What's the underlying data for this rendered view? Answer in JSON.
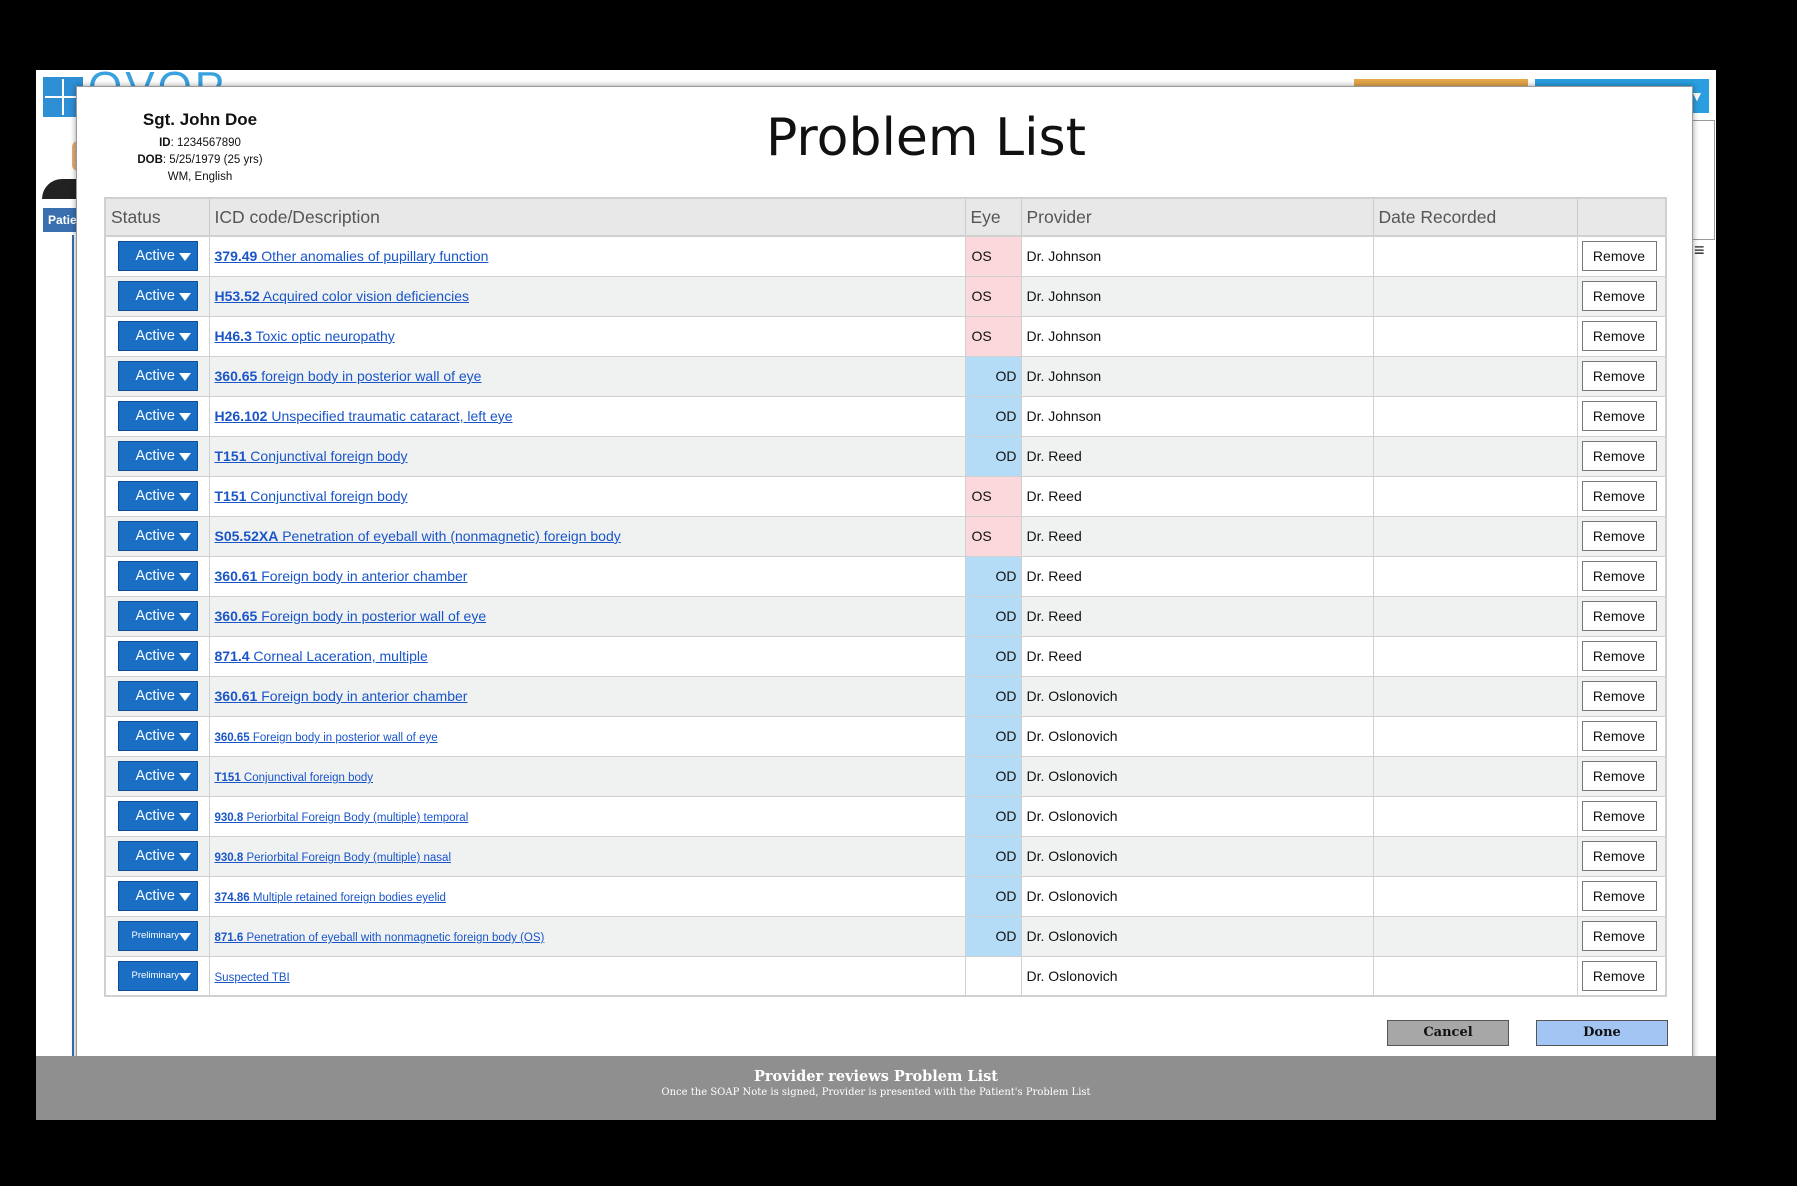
{
  "background": {
    "logo_text": "OVOP",
    "patient_tab_label": "Patient"
  },
  "patient": {
    "name": "Sgt. John Doe",
    "id_label": "ID",
    "id_value": ": 1234567890",
    "dob_label": "DOB",
    "dob_value": ": 5/25/1979 (25 yrs)",
    "demographics": "WM, English"
  },
  "title": "Problem List",
  "table": {
    "headers": {
      "status": "Status",
      "icd": "ICD code/Description",
      "eye": "Eye",
      "provider": "Provider",
      "date": "Date Recorded",
      "action": ""
    },
    "remove_label": "Remove",
    "rows": [
      {
        "status": "Active",
        "code": "379.49",
        "desc": " Other anomalies of pupillary function",
        "eye": "OS",
        "provider": "Dr. Johnson",
        "date": ""
      },
      {
        "status": "Active",
        "code": "H53.52",
        "desc": " Acquired color vision deficiencies",
        "eye": "OS",
        "provider": "Dr. Johnson",
        "date": ""
      },
      {
        "status": "Active",
        "code": "H46.3",
        "desc": " Toxic optic neuropathy",
        "eye": "OS",
        "provider": "Dr. Johnson",
        "date": ""
      },
      {
        "status": "Active",
        "code": "360.65",
        "desc": " foreign body in posterior wall of eye",
        "eye": "OD",
        "provider": "Dr. Johnson",
        "date": ""
      },
      {
        "status": "Active",
        "code": "H26.102",
        "desc": " Unspecified traumatic cataract, left eye",
        "eye": "OD",
        "provider": "Dr. Johnson",
        "date": ""
      },
      {
        "status": "Active",
        "code": "T151",
        "desc": " Conjunctival foreign body",
        "eye": "OD",
        "provider": "Dr. Reed",
        "date": ""
      },
      {
        "status": "Active",
        "code": "T151",
        "desc": " Conjunctival foreign body",
        "eye": "OS",
        "provider": "Dr. Reed",
        "date": ""
      },
      {
        "status": "Active",
        "code": "S05.52XA",
        "desc": " Penetration of eyeball with (nonmagnetic) foreign body",
        "eye": "OS",
        "provider": "Dr. Reed",
        "date": ""
      },
      {
        "status": "Active",
        "code": "360.61",
        "desc": " Foreign body in anterior chamber",
        "eye": "OD",
        "provider": "Dr. Reed",
        "date": ""
      },
      {
        "status": "Active",
        "code": "360.65",
        "desc": " Foreign body in posterior wall of eye",
        "eye": "OD",
        "provider": "Dr. Reed",
        "date": ""
      },
      {
        "status": "Active",
        "code": "871.4",
        "desc": " Corneal Laceration, multiple",
        "eye": "OD",
        "provider": "Dr. Reed",
        "date": ""
      },
      {
        "status": "Active",
        "code": "360.61",
        "desc": " Foreign body in anterior chamber",
        "eye": "OD",
        "provider": "Dr. Oslonovich",
        "date": ""
      },
      {
        "status": "Active",
        "code": "360.65",
        "desc": " Foreign body in posterior wall of eye",
        "eye": "OD",
        "provider": "Dr. Oslonovich",
        "date": "",
        "small": true
      },
      {
        "status": "Active",
        "code": "T151",
        "desc": " Conjunctival foreign body",
        "eye": "OD",
        "provider": "Dr. Oslonovich",
        "date": "",
        "small": true
      },
      {
        "status": "Active",
        "code": "930.8",
        "desc": " Periorbital Foreign Body (multiple) temporal",
        "eye": "OD",
        "provider": "Dr. Oslonovich",
        "date": "",
        "small": true
      },
      {
        "status": "Active",
        "code": "930.8",
        "desc": " Periorbital Foreign Body (multiple) nasal",
        "eye": "OD",
        "provider": "Dr. Oslonovich",
        "date": "",
        "small": true
      },
      {
        "status": "Active",
        "code": "374.86",
        "desc": " Multiple retained foreign bodies eyelid",
        "eye": "OD",
        "provider": "Dr. Oslonovich",
        "date": "",
        "small": true
      },
      {
        "status": "Preliminary",
        "code": "871.6",
        "desc": " Penetration of eyeball with nonmagnetic foreign body (OS)",
        "eye": "OD",
        "provider": "Dr. Oslonovich",
        "date": "",
        "small": true
      },
      {
        "status": "Preliminary",
        "code": "",
        "desc": "Suspected TBI",
        "eye": "",
        "provider": "Dr. Oslonovich",
        "date": "",
        "small": true
      }
    ]
  },
  "buttons": {
    "cancel": "Cancel",
    "done": "Done"
  },
  "caption": {
    "title": "Provider reviews Problem List",
    "subtitle": "Once the SOAP Note is signed, Provider is presented with the Patient's Problem List"
  },
  "colors": {
    "status_button": "#1a6fc4",
    "eye_os": "#fbd8dc",
    "eye_od": "#b5dcf6",
    "link": "#1a55c8",
    "done_button": "#a3c5f3",
    "cancel_button": "#a7a7a7"
  }
}
